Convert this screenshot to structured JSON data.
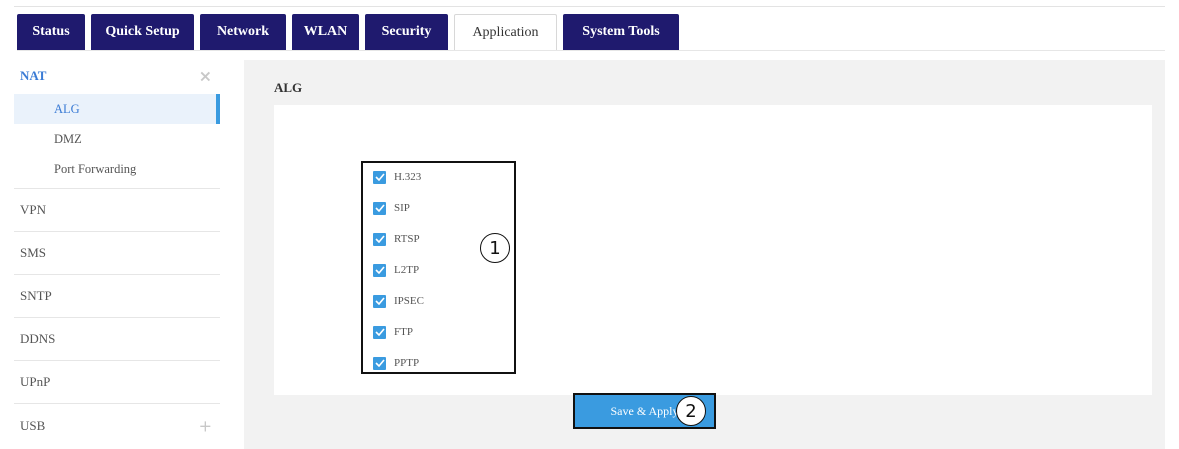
{
  "tabs": [
    {
      "label": "Status"
    },
    {
      "label": "Quick Setup"
    },
    {
      "label": "Network"
    },
    {
      "label": "WLAN"
    },
    {
      "label": "Security"
    },
    {
      "label": "Application"
    },
    {
      "label": "System Tools"
    }
  ],
  "sidebar": {
    "nat": {
      "label": "NAT",
      "control": "×"
    },
    "nat_sub": [
      {
        "label": "ALG"
      },
      {
        "label": "DMZ"
      },
      {
        "label": "Port Forwarding"
      }
    ],
    "items": [
      {
        "label": "VPN"
      },
      {
        "label": "SMS"
      },
      {
        "label": "SNTP"
      },
      {
        "label": "DDNS"
      },
      {
        "label": "UPnP"
      },
      {
        "label": "USB",
        "control": "+"
      }
    ]
  },
  "main": {
    "title": "ALG",
    "options": [
      {
        "label": "H.323",
        "checked": true
      },
      {
        "label": "SIP",
        "checked": true
      },
      {
        "label": "RTSP",
        "checked": true
      },
      {
        "label": "L2TP",
        "checked": true
      },
      {
        "label": "IPSEC",
        "checked": true
      },
      {
        "label": "FTP",
        "checked": true
      },
      {
        "label": "PPTP",
        "checked": true
      }
    ],
    "save_label": "Save & Apply",
    "marker_1": "1",
    "marker_2": "2"
  },
  "colors": {
    "tab_bg": "#1f1a6e",
    "accent": "#3a9be0",
    "link": "#3a7bd5"
  }
}
